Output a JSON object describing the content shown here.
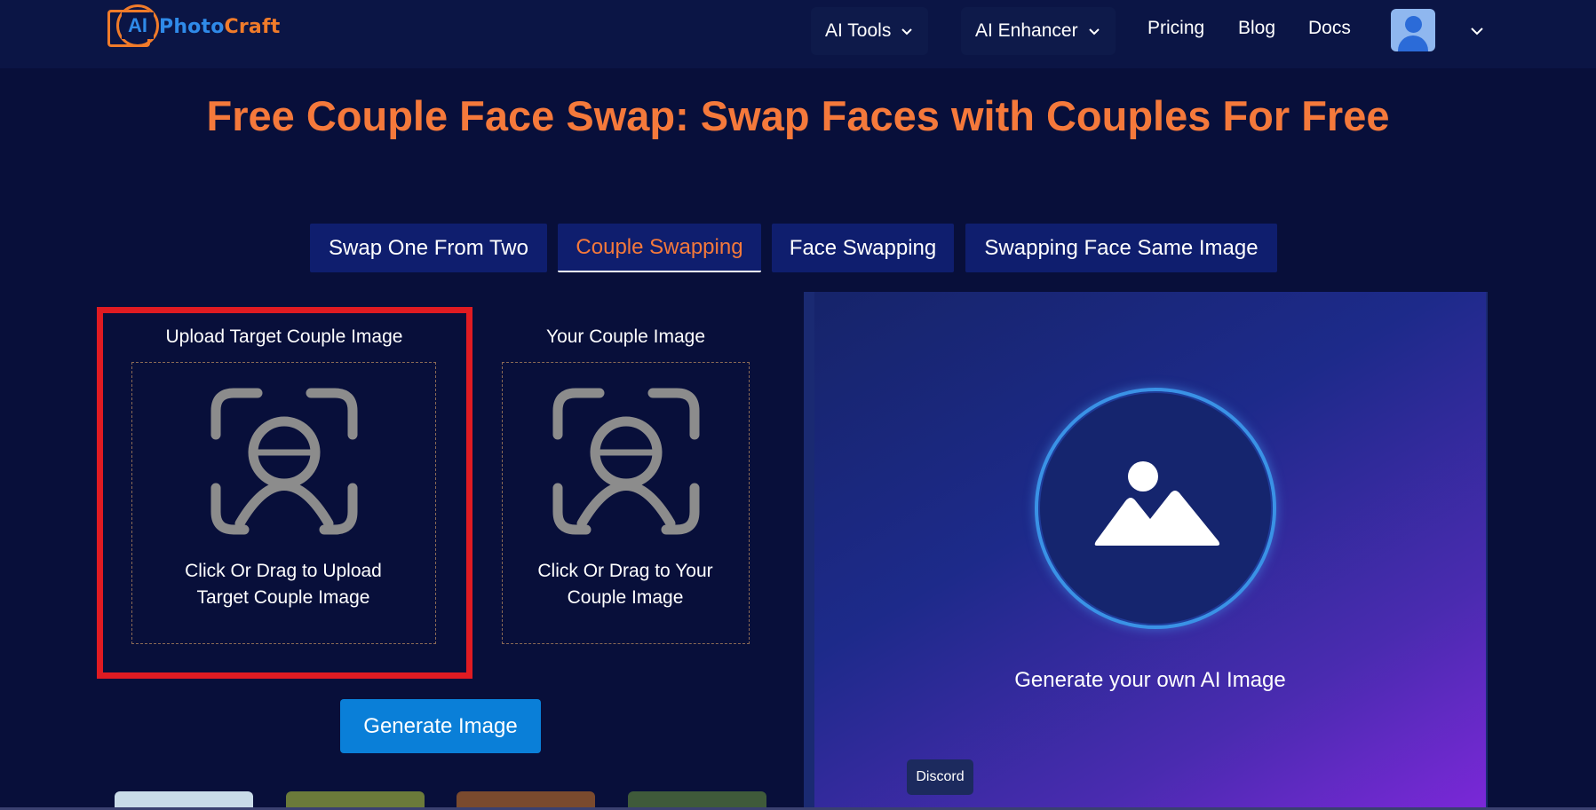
{
  "header": {
    "logo": {
      "mark_text": "AI",
      "text_part1": "Photo",
      "text_part2": "Craft"
    },
    "nav": {
      "ai_tools": "AI Tools",
      "ai_enhancer": "AI Enhancer",
      "pricing": "Pricing",
      "blog": "Blog",
      "docs": "Docs"
    },
    "icons": {
      "dropdown": "chevron-down-icon",
      "avatar": "user-avatar-icon"
    }
  },
  "title": "Free Couple Face Swap: Swap Faces with Couples For Free",
  "tabs": [
    {
      "label": "Swap One From Two",
      "active": false
    },
    {
      "label": "Couple Swapping",
      "active": true
    },
    {
      "label": "Face Swapping",
      "active": false
    },
    {
      "label": "Swapping Face Same Image",
      "active": false
    }
  ],
  "uploads": {
    "target": {
      "label": "Upload Target Couple Image",
      "hint_line1": "Click Or Drag to Upload",
      "hint_line2": "Target Couple Image"
    },
    "yours": {
      "label": "Your Couple Image",
      "hint_line1": "Click Or Drag to Your",
      "hint_line2": "Couple Image"
    }
  },
  "generate_button": "Generate Image",
  "preview": {
    "text": "Generate your own AI Image",
    "icon": "image-placeholder-icon"
  },
  "discord": "Discord",
  "colors": {
    "background": "#080f3a",
    "header": "#0b1545",
    "accent_orange": "#f5793b",
    "tab_bg": "#0f1e6e",
    "button_blue": "#0a7fd8",
    "highlight_red": "#e01b22"
  }
}
